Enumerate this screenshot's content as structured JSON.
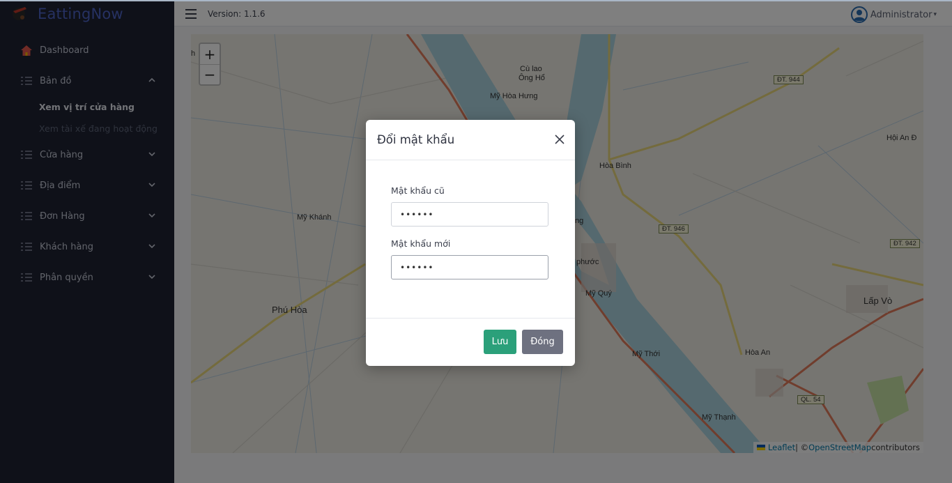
{
  "app": {
    "brand": "EattingNow",
    "version": "Version: 1.1.6",
    "user": "Administrator"
  },
  "sidebar": {
    "items": [
      {
        "label": "Dashboard",
        "icon": "home-icon"
      },
      {
        "label": "Bản đồ",
        "icon": "list-icon",
        "expanded": true,
        "children": [
          {
            "label": "Xem vị trí cửa hàng",
            "active": true
          },
          {
            "label": "Xem tài xế đang hoạt động",
            "active": false
          }
        ]
      },
      {
        "label": "Cửa hàng",
        "icon": "list-icon"
      },
      {
        "label": "Địa điểm",
        "icon": "list-icon"
      },
      {
        "label": "Đơn Hàng",
        "icon": "list-icon"
      },
      {
        "label": "Khách hàng",
        "icon": "list-icon"
      },
      {
        "label": "Phân quyền",
        "icon": "list-icon"
      }
    ]
  },
  "map": {
    "zoom_in": "+",
    "zoom_out": "−",
    "attribution": {
      "leaflet": "Leaflet",
      "sep": " | © ",
      "osm": "OpenStreetMap",
      "contrib": " contributors"
    },
    "labels": [
      "Cù lao",
      "Ông Hổ",
      "Mỹ Hòa Hưng",
      "Hòa Bình",
      "Mỹ Khánh",
      "Phú Hòa",
      "Mỹ Quý",
      "Mỹ Thới",
      "Mỹ Thạnh",
      "Hòa An",
      "Lấp Vò",
      "Hội An Đ",
      "ng",
      "phước",
      "h"
    ],
    "shields": [
      "ĐT. 944",
      "ĐT. 946",
      "ĐT. 942",
      "QL. 54"
    ]
  },
  "modal": {
    "title": "Đổi mật khẩu",
    "old_label": "Mật khẩu cũ",
    "old_value": "••••••",
    "new_label": "Mật khẩu mới",
    "new_value": "••••••",
    "save": "Lưu",
    "close": "Đóng"
  },
  "colors": {
    "sidebar": "#1e2233",
    "brand": "#4c63c4",
    "save": "#2ba07a",
    "close": "#6e7180",
    "river": "#aad3df"
  }
}
